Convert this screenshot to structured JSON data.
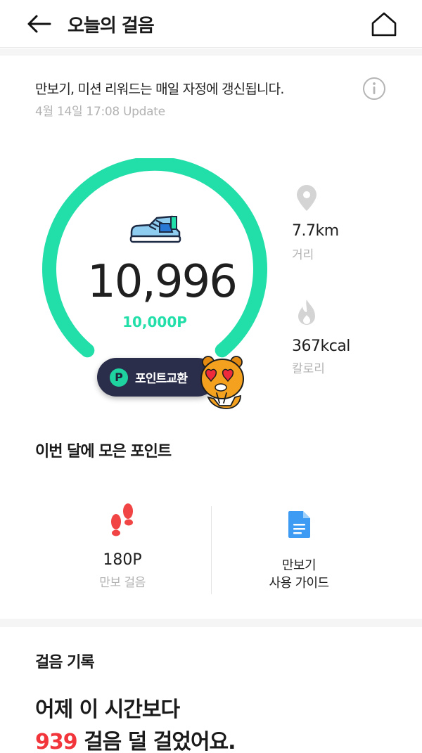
{
  "header": {
    "title": "오늘의 걸음",
    "back_icon": "arrow-left-icon",
    "home_icon": "home-icon"
  },
  "notice": {
    "text": "만보기, 미션 리워드는 매일 자정에 갱신됩니다.",
    "updated": "4월 14일 17:08 Update",
    "info_icon": "info-icon"
  },
  "pedometer": {
    "steps": "10,996",
    "points": "10,000P",
    "progress": 1.0,
    "accent_color": "#22dfaa",
    "exchange_button": {
      "badge": "P",
      "label": "포인트교환"
    },
    "stats": {
      "distance": {
        "value": "7.7km",
        "label": "거리",
        "icon": "location-pin-icon"
      },
      "calories": {
        "value": "367kcal",
        "label": "칼로리",
        "icon": "flame-icon"
      }
    }
  },
  "monthly": {
    "title": "이번 달에 모은 포인트",
    "steps_points": {
      "value": "180P",
      "label": "만보 걸음",
      "icon": "footprints-icon"
    },
    "guide": {
      "line1": "만보기",
      "line2": "사용 가이드",
      "icon": "document-icon"
    }
  },
  "history": {
    "title": "걸음 기록",
    "line1": "어제 이 시간보다",
    "diff": "939",
    "line2_rest": " 걸음 덜 걸었어요.",
    "highlight_color": "#f2353a"
  }
}
